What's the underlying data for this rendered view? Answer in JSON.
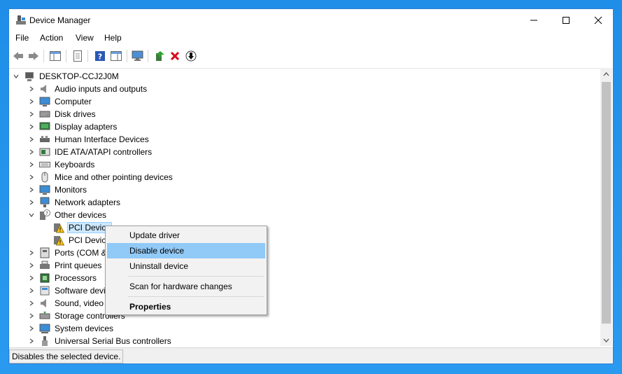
{
  "window": {
    "title": "Device Manager"
  },
  "menu": [
    "File",
    "Action",
    "View",
    "Help"
  ],
  "toolbar": [
    "back-icon",
    "forward-icon",
    "show-hide-console-tree-icon",
    "properties-icon",
    "help-icon",
    "action-pane-icon",
    "scan-hardware-icon",
    "update-driver-icon",
    "uninstall-device-icon",
    "disable-device-icon"
  ],
  "tree": {
    "root": "DESKTOP-CCJ2J0M",
    "categories": [
      "Audio inputs and outputs",
      "Computer",
      "Disk drives",
      "Display adapters",
      "Human Interface Devices",
      "IDE ATA/ATAPI controllers",
      "Keyboards",
      "Mice and other pointing devices",
      "Monitors",
      "Network adapters",
      "Other devices"
    ],
    "other_children": [
      "PCI Device",
      "PCI Device"
    ],
    "categories_after": [
      "Ports (COM & LPT)",
      "Print queues",
      "Processors",
      "Software devices",
      "Sound, video and game controllers",
      "Storage controllers",
      "System devices",
      "Universal Serial Bus controllers"
    ]
  },
  "context_menu": {
    "items": [
      "Update driver",
      "Disable device",
      "Uninstall device",
      "Scan for hardware changes",
      "Properties"
    ],
    "highlighted": "Disable device"
  },
  "status": {
    "text": "Disables the selected device."
  },
  "colors": {
    "desktop": "#1f8ee8",
    "highlight": "#91c9f7",
    "selection": "#cce8ff",
    "delete_red": "#d9001b"
  }
}
